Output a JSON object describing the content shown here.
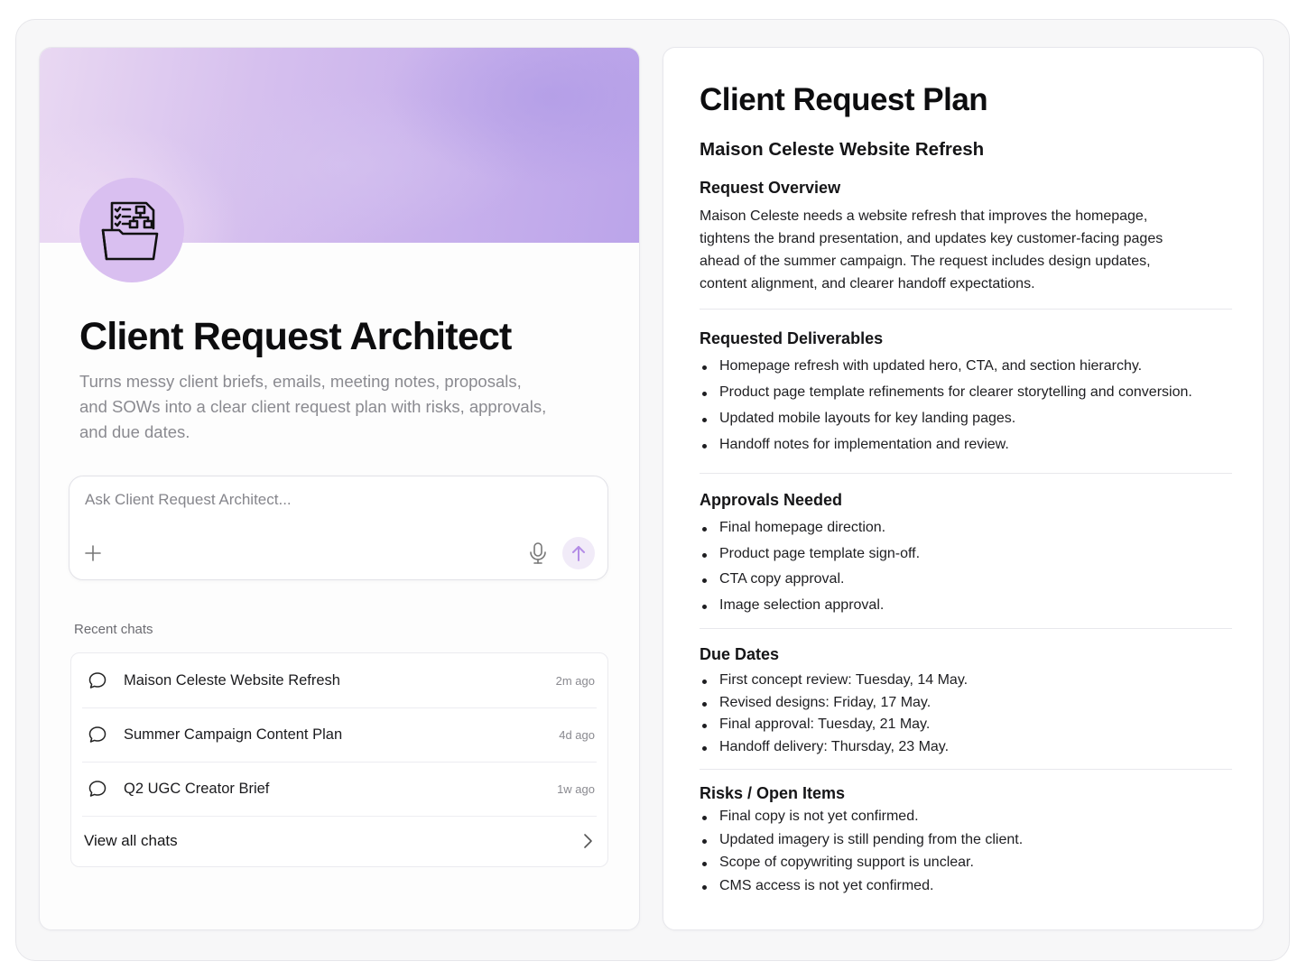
{
  "assistant": {
    "title": "Client Request Architect",
    "description": "Turns messy client briefs, emails, meeting notes, proposals, and SOWs into a clear client request plan with risks, approvals, and due dates."
  },
  "composer": {
    "placeholder": "Ask Client Request Architect...",
    "send_icon": "arrow-up-icon",
    "mic_icon": "microphone-icon",
    "add_icon": "plus-icon"
  },
  "recent": {
    "label": "Recent chats",
    "items": [
      {
        "title": "Maison Celeste Website Refresh",
        "time": "2m ago"
      },
      {
        "title": "Summer Campaign Content Plan",
        "time": "4d ago"
      },
      {
        "title": "Q2 UGC Creator Brief",
        "time": "1w ago"
      }
    ],
    "view_all": "View all chats"
  },
  "plan": {
    "title": "Client Request Plan",
    "subtitle": "Maison Celeste Website Refresh",
    "overview": {
      "heading": "Request Overview",
      "text": "Maison Celeste needs a website refresh that improves the homepage, tightens the brand presentation, and updates key customer-facing pages ahead of the summer campaign. The request includes design updates, content alignment, and clearer handoff expectations."
    },
    "deliverables": {
      "heading": "Requested Deliverables",
      "items": [
        "Homepage refresh with updated hero, CTA, and section hierarchy.",
        "Product page template refinements for clearer storytelling and conversion.",
        "Updated mobile layouts for key landing pages.",
        "Handoff notes for implementation and review."
      ]
    },
    "approvals": {
      "heading": "Approvals Needed",
      "items": [
        "Final homepage direction.",
        "Product page template sign-off.",
        "CTA copy approval.",
        "Image selection approval."
      ]
    },
    "due_dates": {
      "heading": "Due Dates",
      "items": [
        "First concept review: Tuesday, 14 May.",
        "Revised designs: Friday, 17 May.",
        "Final approval: Tuesday, 21 May.",
        "Handoff delivery: Thursday, 23 May."
      ]
    },
    "risks": {
      "heading": "Risks / Open Items",
      "items": [
        "Final copy is not yet confirmed.",
        "Updated imagery is still pending from the client.",
        "Scope of copywriting support is unclear.",
        "CMS access is not yet confirmed."
      ]
    }
  },
  "colors": {
    "accent": "#b89be8",
    "avatar_bg": "#d9bff0",
    "send_bg": "#f1ebf8"
  }
}
